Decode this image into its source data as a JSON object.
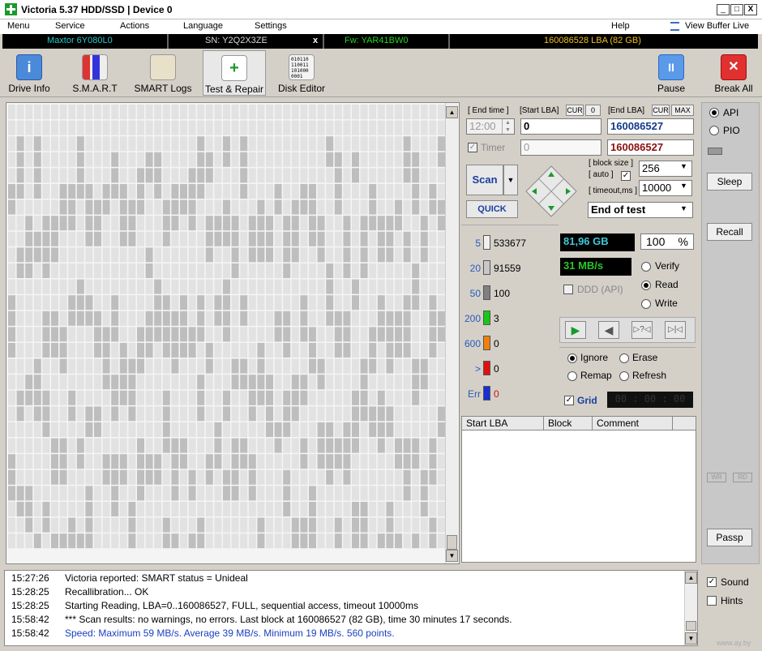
{
  "window": {
    "title": "Victoria 5.37 HDD/SSD | Device 0",
    "min": "_",
    "max": "□",
    "close": "X"
  },
  "menu": {
    "items": [
      "Menu",
      "Service",
      "Actions",
      "Language",
      "Settings",
      "Help"
    ],
    "view_buffer": "View Buffer Live"
  },
  "device": {
    "model": "Maxtor 6Y080L0",
    "serial": "SN: Y2Q2X3ZE",
    "x": "x",
    "firmware": "Fw: YAR41BW0",
    "lba": "160086528 LBA (82 GB)"
  },
  "toolbar": {
    "drive_info": "Drive Info",
    "smart": "S.M.A.R.T",
    "smart_logs": "SMART Logs",
    "test_repair": "Test & Repair",
    "disk_editor": "Disk Editor",
    "pause": "Pause",
    "break_all": "Break All"
  },
  "scan": {
    "end_time_label": "[ End time ]",
    "start_lba_label": "[Start LBA]",
    "cur_label": "CUR",
    "zero": "0",
    "end_lba_label": "[End LBA]",
    "max_label": "MAX",
    "end_time": "12:00",
    "start_lba": "0",
    "end_lba": "160086527",
    "timer_label": "Timer",
    "timer_value": "0",
    "end_lba2": "160086527",
    "scan_btn": "Scan",
    "quick_btn": "QUICK",
    "block_size_label": "[ block size ]",
    "auto_label": "[ auto ]",
    "block_size": "256",
    "timeout_label": "[ timeout,ms ]",
    "timeout": "10000",
    "end_action": "End of test"
  },
  "legend": [
    {
      "ms": "5",
      "count": "533677",
      "color": "#f0f0f0"
    },
    {
      "ms": "20",
      "count": "91559",
      "color": "#c8c8c8"
    },
    {
      "ms": "50",
      "count": "100",
      "color": "#808080"
    },
    {
      "ms": "200",
      "count": "3",
      "color": "#18c818"
    },
    {
      "ms": "600",
      "count": "0",
      "color": "#f08010"
    },
    {
      "ms": ">",
      "count": "0",
      "color": "#e01010"
    },
    {
      "ms": "Err",
      "count": "0",
      "color": "#1830d0"
    }
  ],
  "stats": {
    "size": "81,96 GB",
    "percent": "100",
    "pct_sign": "%",
    "speed": "31 MB/s",
    "ddd": "DDD (API)"
  },
  "mode": {
    "verify": "Verify",
    "read": "Read",
    "write": "Write"
  },
  "errmode": {
    "ignore": "Ignore",
    "erase": "Erase",
    "remap": "Remap",
    "refresh": "Refresh"
  },
  "grid_label": "Grid",
  "grid_timer": "00 : 00 : 00",
  "table": {
    "columns": [
      "Start LBA",
      "Block",
      "Comment"
    ]
  },
  "side": {
    "api": "API",
    "pio": "PIO",
    "sleep": "Sleep",
    "recall": "Recall",
    "wr": "WR",
    "rd": "RD",
    "passp": "Passp",
    "sound": "Sound",
    "hints": "Hints"
  },
  "log": [
    {
      "time": "15:27:26",
      "msg": "Victoria reported: SMART status = Unideal",
      "color": "#000"
    },
    {
      "time": "15:28:25",
      "msg": "Recallibration... OK",
      "color": "#000"
    },
    {
      "time": "15:28:25",
      "msg": "Starting Reading, LBA=0..160086527, FULL, sequential access, timeout 10000ms",
      "color": "#000"
    },
    {
      "time": "15:58:42",
      "msg": "*** Scan results: no warnings, no errors. Last block at 160086527 (82 GB), time 30 minutes 17 seconds.",
      "color": "#000"
    },
    {
      "time": "15:58:42",
      "msg": "Speed: Maximum 59 MB/s. Average 39 MB/s. Minimum 19 MB/s. 560 points.",
      "color": "#1a3fc0"
    }
  ],
  "watermark": "www.ay.by"
}
